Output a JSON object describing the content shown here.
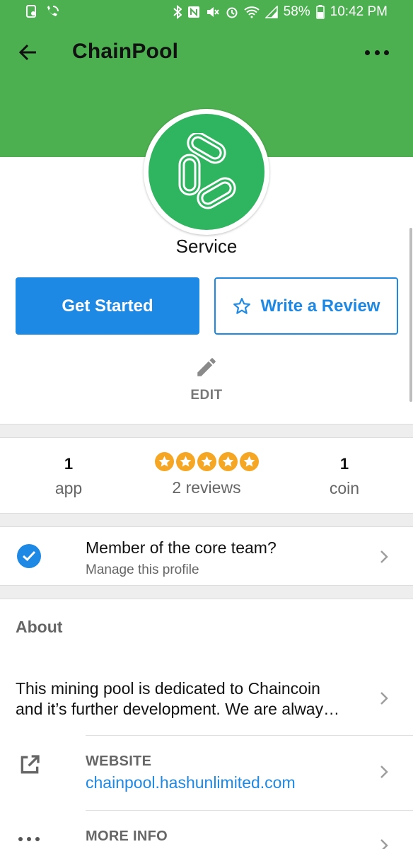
{
  "status_bar": {
    "battery": "58%",
    "time": "10:42 PM",
    "left_icons": [
      "sd-card-icon",
      "wifi-call-icon"
    ],
    "right_icons": [
      "bluetooth-icon",
      "nfc-icon",
      "mute-icon",
      "alarm-icon",
      "wifi-icon",
      "signal-icon",
      "battery-icon"
    ]
  },
  "app_bar": {
    "title": "ChainPool"
  },
  "profile": {
    "category": "Service",
    "primary_button": "Get Started",
    "review_button": "Write a Review",
    "edit_label": "EDIT"
  },
  "stats": {
    "apps": {
      "count": "1",
      "label": "app"
    },
    "rating": {
      "stars": 5,
      "reviews_label": "2 reviews"
    },
    "coins": {
      "count": "1",
      "label": "coin"
    }
  },
  "membership": {
    "title": "Member of the core team?",
    "subtitle": "Manage this profile"
  },
  "about": {
    "heading": "About",
    "description_line1": "This mining pool is dedicated to Chaincoin",
    "description_line2": "and it’s further development. We are alway…",
    "website_label": "WEBSITE",
    "website_url": "chainpool.hashunlimited.com",
    "more_info_label": "MORE INFO"
  },
  "colors": {
    "brand_green": "#4caf50",
    "logo_green": "#2fb45f",
    "accent_blue": "#1e88e5",
    "star_orange": "#f5a623"
  }
}
